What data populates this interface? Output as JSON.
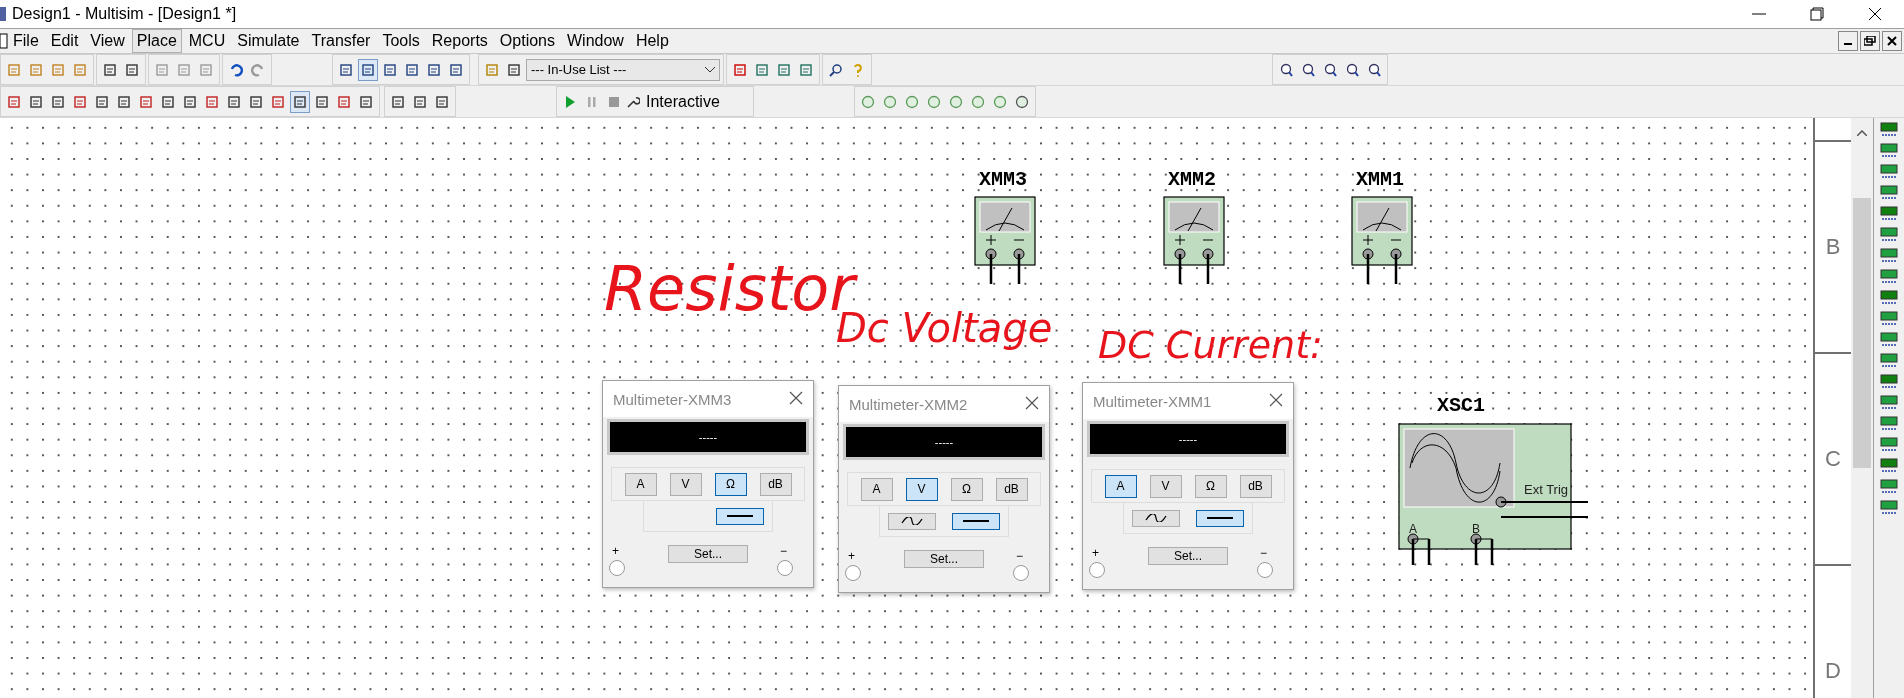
{
  "window": {
    "title": "Design1 - Multisim - [Design1 *]"
  },
  "menu": [
    {
      "label": "File",
      "selected": false
    },
    {
      "label": "Edit",
      "selected": false
    },
    {
      "label": "View",
      "selected": false
    },
    {
      "label": "Place",
      "selected": true
    },
    {
      "label": "MCU",
      "selected": false
    },
    {
      "label": "Simulate",
      "selected": false
    },
    {
      "label": "Transfer",
      "selected": false
    },
    {
      "label": "Tools",
      "selected": false
    },
    {
      "label": "Reports",
      "selected": false
    },
    {
      "label": "Options",
      "selected": false
    },
    {
      "label": "Window",
      "selected": false
    },
    {
      "label": "Help",
      "selected": false
    }
  ],
  "toolbar": {
    "in_use_list": "--- In-Use List ---",
    "sim_mode": "Interactive"
  },
  "canvas": {
    "notes": [
      "Resistor",
      "Dc Voltage",
      "DC Current:"
    ],
    "instruments": [
      {
        "kind": "multimeter",
        "label": "XMM3"
      },
      {
        "kind": "multimeter",
        "label": "XMM2"
      },
      {
        "kind": "multimeter",
        "label": "XMM1"
      },
      {
        "kind": "oscilloscope",
        "label": "XSC1",
        "trigger": "Ext Trig",
        "channels": [
          "A",
          "B"
        ]
      }
    ],
    "border_labels": [
      "B",
      "C",
      "D"
    ]
  },
  "multimeter_windows": [
    {
      "title": "Multimeter-XMM3",
      "display": "-----",
      "modes": [
        {
          "label": "A",
          "selected": false
        },
        {
          "label": "V",
          "selected": false
        },
        {
          "label": "Ω",
          "selected": true
        },
        {
          "label": "dB",
          "selected": false
        }
      ],
      "signal": [
        {
          "kind": "dc",
          "selected": true
        }
      ],
      "set": "Set...",
      "plus": "+",
      "minus": "−"
    },
    {
      "title": "Multimeter-XMM2",
      "display": "-----",
      "modes": [
        {
          "label": "A",
          "selected": false
        },
        {
          "label": "V",
          "selected": true
        },
        {
          "label": "Ω",
          "selected": false
        },
        {
          "label": "dB",
          "selected": false
        }
      ],
      "signal": [
        {
          "kind": "ac",
          "selected": false
        },
        {
          "kind": "dc",
          "selected": true
        }
      ],
      "set": "Set...",
      "plus": "+",
      "minus": "−"
    },
    {
      "title": "Multimeter-XMM1",
      "display": "-----",
      "modes": [
        {
          "label": "A",
          "selected": true
        },
        {
          "label": "V",
          "selected": false
        },
        {
          "label": "Ω",
          "selected": false
        },
        {
          "label": "dB",
          "selected": false
        }
      ],
      "signal": [
        {
          "kind": "ac",
          "selected": false
        },
        {
          "kind": "dc",
          "selected": true
        }
      ],
      "set": "Set...",
      "plus": "+",
      "minus": "−"
    }
  ]
}
